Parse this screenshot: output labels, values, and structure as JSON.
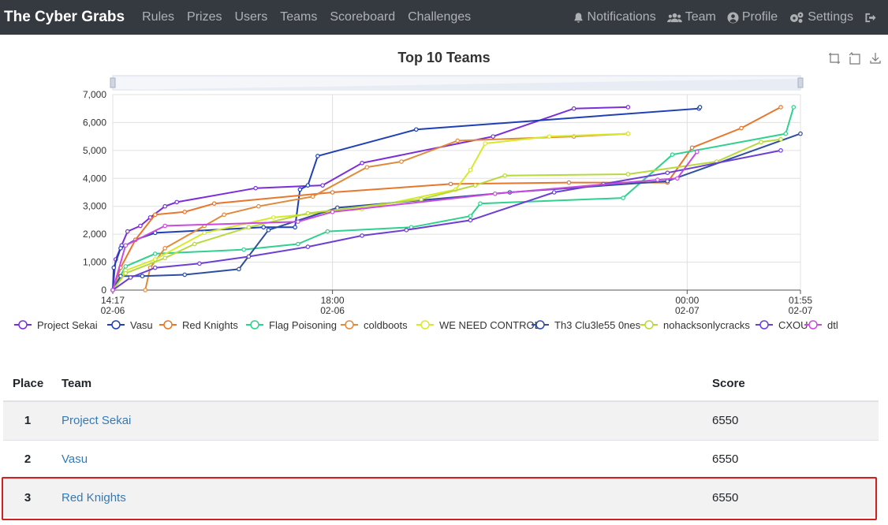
{
  "navbar": {
    "brand": "The Cyber Grabs",
    "links": [
      "Rules",
      "Prizes",
      "Users",
      "Teams",
      "Scoreboard",
      "Challenges"
    ],
    "right_links": [
      {
        "label": "Notifications",
        "icon": "bell-icon"
      },
      {
        "label": "Team",
        "icon": "users-icon"
      },
      {
        "label": "Profile",
        "icon": "user-circle-icon"
      },
      {
        "label": "Settings",
        "icon": "gears-icon"
      },
      {
        "label": "",
        "icon": "sign-out-icon"
      }
    ]
  },
  "chart_toolbox": [
    "zoom-icon",
    "zoom-reset-icon",
    "download-icon"
  ],
  "chart_data": {
    "type": "line",
    "title": "Top 10 Teams",
    "xlabel": "",
    "ylabel": "",
    "ylim": [
      0,
      7000
    ],
    "y_ticks": [
      "0",
      "1,000",
      "2,000",
      "3,000",
      "4,000",
      "5,000",
      "6,000",
      "7,000"
    ],
    "x_range": [
      "2023-02-06 14:17",
      "2023-02-07 01:55"
    ],
    "x_ticks": [
      {
        "t": "2023-02-06 14:17",
        "line1": "14:17",
        "line2": "02-06"
      },
      {
        "t": "2023-02-06 18:00",
        "line1": "18:00",
        "line2": "02-06"
      },
      {
        "t": "2023-02-07 00:00",
        "line1": "00:00",
        "line2": "02-07"
      },
      {
        "t": "2023-02-07 01:55",
        "line1": "01:55",
        "line2": "02-07"
      }
    ],
    "grid": true,
    "legend": "bottom",
    "series": [
      {
        "name": "Project Sekai",
        "color": "#7a2edb",
        "points": [
          [
            "2023-02-06 14:17",
            0
          ],
          [
            "2023-02-06 14:20",
            1100
          ],
          [
            "2023-02-06 14:26",
            1600
          ],
          [
            "2023-02-06 14:32",
            2100
          ],
          [
            "2023-02-06 14:45",
            2300
          ],
          [
            "2023-02-06 14:55",
            2600
          ],
          [
            "2023-02-06 15:10",
            3000
          ],
          [
            "2023-02-06 15:22",
            3150
          ],
          [
            "2023-02-06 16:42",
            3650
          ],
          [
            "2023-02-06 17:50",
            3750
          ],
          [
            "2023-02-06 18:30",
            4550
          ],
          [
            "2023-02-06 20:43",
            5500
          ],
          [
            "2023-02-06 22:05",
            6500
          ],
          [
            "2023-02-06 23:00",
            6550
          ]
        ]
      },
      {
        "name": "Vasu",
        "color": "#1f3fb5",
        "points": [
          [
            "2023-02-06 14:17",
            0
          ],
          [
            "2023-02-06 14:18",
            800
          ],
          [
            "2023-02-06 14:25",
            1500
          ],
          [
            "2023-02-06 14:40",
            1800
          ],
          [
            "2023-02-06 15:00",
            2050
          ],
          [
            "2023-02-06 16:50",
            2250
          ],
          [
            "2023-02-06 17:22",
            2250
          ],
          [
            "2023-02-06 17:27",
            3600
          ],
          [
            "2023-02-06 17:35",
            3750
          ],
          [
            "2023-02-06 17:45",
            4800
          ],
          [
            "2023-02-06 19:25",
            5750
          ],
          [
            "2023-02-07 00:12",
            6500
          ],
          [
            "2023-02-07 00:13",
            6550
          ]
        ]
      },
      {
        "name": "Red Knights",
        "color": "#e8762c",
        "points": [
          [
            "2023-02-06 14:17",
            0
          ],
          [
            "2023-02-06 14:25",
            800
          ],
          [
            "2023-02-06 14:40",
            1800
          ],
          [
            "2023-02-06 15:00",
            2700
          ],
          [
            "2023-02-06 15:30",
            2800
          ],
          [
            "2023-02-06 16:00",
            3100
          ],
          [
            "2023-02-06 18:00",
            3500
          ],
          [
            "2023-02-06 20:00",
            3800
          ],
          [
            "2023-02-06 22:00",
            3850
          ],
          [
            "2023-02-06 23:40",
            3850
          ],
          [
            "2023-02-07 00:05",
            5100
          ],
          [
            "2023-02-07 00:55",
            5800
          ],
          [
            "2023-02-07 01:35",
            6550
          ]
        ]
      },
      {
        "name": "Flag Poisoning",
        "color": "#2ed18e",
        "points": [
          [
            "2023-02-06 14:17",
            0
          ],
          [
            "2023-02-06 14:30",
            850
          ],
          [
            "2023-02-06 15:00",
            1300
          ],
          [
            "2023-02-06 16:30",
            1450
          ],
          [
            "2023-02-06 17:25",
            1650
          ],
          [
            "2023-02-06 17:55",
            2100
          ],
          [
            "2023-02-06 19:20",
            2250
          ],
          [
            "2023-02-06 20:20",
            2650
          ],
          [
            "2023-02-06 20:30",
            3100
          ],
          [
            "2023-02-06 22:55",
            3300
          ],
          [
            "2023-02-06 23:45",
            4850
          ],
          [
            "2023-02-07 01:40",
            5600
          ],
          [
            "2023-02-07 01:48",
            6550
          ]
        ]
      },
      {
        "name": "coldboots",
        "color": "#e08a3c",
        "points": [
          [
            "2023-02-06 14:50",
            0
          ],
          [
            "2023-02-06 14:55",
            800
          ],
          [
            "2023-02-06 15:10",
            1500
          ],
          [
            "2023-02-06 15:50",
            2300
          ],
          [
            "2023-02-06 16:10",
            2700
          ],
          [
            "2023-02-06 16:45",
            3000
          ],
          [
            "2023-02-06 17:40",
            3350
          ],
          [
            "2023-02-06 18:35",
            4400
          ],
          [
            "2023-02-06 19:10",
            4600
          ],
          [
            "2023-02-06 20:07",
            5350
          ],
          [
            "2023-02-06 22:05",
            5500
          ],
          [
            "2023-02-06 23:00",
            5600
          ]
        ]
      },
      {
        "name": "WE NEED CONTROL",
        "color": "#d7ea2a",
        "points": [
          [
            "2023-02-06 14:17",
            0
          ],
          [
            "2023-02-06 14:30",
            700
          ],
          [
            "2023-02-06 15:00",
            1100
          ],
          [
            "2023-02-06 15:50",
            2050
          ],
          [
            "2023-02-06 17:00",
            2600
          ],
          [
            "2023-02-06 18:30",
            2900
          ],
          [
            "2023-02-06 20:05",
            3600
          ],
          [
            "2023-02-06 20:20",
            4300
          ],
          [
            "2023-02-06 20:35",
            5250
          ],
          [
            "2023-02-06 21:40",
            5500
          ],
          [
            "2023-02-06 23:00",
            5600
          ]
        ]
      },
      {
        "name": "Th3 Clu3le55 0nes",
        "color": "#2d4f9e",
        "points": [
          [
            "2023-02-06 14:17",
            0
          ],
          [
            "2023-02-06 14:25",
            500
          ],
          [
            "2023-02-06 14:47",
            500
          ],
          [
            "2023-02-06 15:30",
            550
          ],
          [
            "2023-02-06 16:25",
            750
          ],
          [
            "2023-02-06 16:55",
            2150
          ],
          [
            "2023-02-06 18:05",
            2950
          ],
          [
            "2023-02-06 21:00",
            3500
          ],
          [
            "2023-02-06 23:40",
            3900
          ],
          [
            "2023-02-07 01:55",
            5600
          ]
        ]
      },
      {
        "name": "nohacksonlycracks",
        "color": "#b7d93b",
        "points": [
          [
            "2023-02-06 14:17",
            0
          ],
          [
            "2023-02-06 14:30",
            600
          ],
          [
            "2023-02-06 15:10",
            1150
          ],
          [
            "2023-02-06 15:40",
            1650
          ],
          [
            "2023-02-06 16:35",
            2250
          ],
          [
            "2023-02-06 17:35",
            2750
          ],
          [
            "2023-02-06 19:30",
            3250
          ],
          [
            "2023-02-06 20:25",
            3750
          ],
          [
            "2023-02-06 20:55",
            4100
          ],
          [
            "2023-02-06 23:00",
            4150
          ],
          [
            "2023-02-07 00:30",
            4600
          ],
          [
            "2023-02-07 01:15",
            5300
          ],
          [
            "2023-02-07 01:35",
            5400
          ]
        ]
      },
      {
        "name": "CXOU",
        "color": "#6b3ed6",
        "points": [
          [
            "2023-02-06 14:17",
            0
          ],
          [
            "2023-02-06 14:35",
            450
          ],
          [
            "2023-02-06 15:00",
            800
          ],
          [
            "2023-02-06 15:45",
            950
          ],
          [
            "2023-02-06 16:35",
            1200
          ],
          [
            "2023-02-06 17:35",
            1550
          ],
          [
            "2023-02-06 18:30",
            1950
          ],
          [
            "2023-02-06 19:15",
            2150
          ],
          [
            "2023-02-06 20:20",
            2500
          ],
          [
            "2023-02-06 21:45",
            3500
          ],
          [
            "2023-02-06 22:35",
            3800
          ],
          [
            "2023-02-06 23:40",
            4200
          ],
          [
            "2023-02-07 01:35",
            5000
          ]
        ]
      },
      {
        "name": "dtl",
        "color": "#c94ae0",
        "points": [
          [
            "2023-02-06 14:17",
            0
          ],
          [
            "2023-02-06 14:30",
            1600
          ],
          [
            "2023-02-06 15:10",
            2300
          ],
          [
            "2023-02-06 17:25",
            2450
          ],
          [
            "2023-02-06 18:00",
            2800
          ],
          [
            "2023-02-06 20:45",
            3450
          ],
          [
            "2023-02-06 23:30",
            3950
          ],
          [
            "2023-02-06 23:50",
            4000
          ],
          [
            "2023-02-07 00:10",
            4950
          ]
        ]
      }
    ]
  },
  "table": {
    "headers": {
      "place": "Place",
      "team": "Team",
      "score": "Score"
    },
    "rows": [
      {
        "place": "1",
        "team": "Project Sekai",
        "score": "6550"
      },
      {
        "place": "2",
        "team": "Vasu",
        "score": "6550"
      },
      {
        "place": "3",
        "team": "Red Knights",
        "score": "6550"
      }
    ]
  }
}
